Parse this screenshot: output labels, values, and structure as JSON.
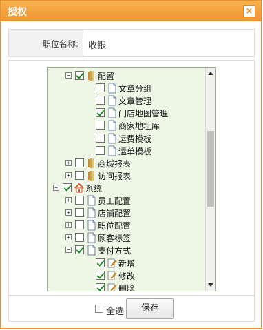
{
  "dialog": {
    "title": "授权",
    "close_label": "×"
  },
  "field": {
    "label": "职位名称:",
    "value": "收银"
  },
  "tree": {
    "nodes": [
      {
        "label": "配置",
        "expander": "−",
        "checked": true,
        "icon": "folder-icon"
      },
      {
        "label": "文章分组",
        "expander": "",
        "checked": false,
        "icon": "page-icon"
      },
      {
        "label": "文章管理",
        "expander": "",
        "checked": false,
        "icon": "page-icon"
      },
      {
        "label": "门店地图管理",
        "expander": "",
        "checked": true,
        "icon": "page-icon"
      },
      {
        "label": "商家地址库",
        "expander": "",
        "checked": false,
        "icon": "page-icon"
      },
      {
        "label": "运费模板",
        "expander": "",
        "checked": false,
        "icon": "page-icon"
      },
      {
        "label": "运单模板",
        "expander": "",
        "checked": false,
        "icon": "page-icon"
      },
      {
        "label": "商城报表",
        "expander": "+",
        "checked": false,
        "icon": "folder-icon"
      },
      {
        "label": "访问报表",
        "expander": "+",
        "checked": false,
        "icon": "folder-icon"
      },
      {
        "label": "系统",
        "expander": "−",
        "checked": true,
        "icon": "home-icon"
      },
      {
        "label": "员工配置",
        "expander": "+",
        "checked": false,
        "icon": "page-icon"
      },
      {
        "label": "店铺配置",
        "expander": "+",
        "checked": false,
        "icon": "page-icon"
      },
      {
        "label": "职位配置",
        "expander": "+",
        "checked": false,
        "icon": "page-icon"
      },
      {
        "label": "顾客标签",
        "expander": "+",
        "checked": false,
        "icon": "page-icon"
      },
      {
        "label": "支付方式",
        "expander": "−",
        "checked": true,
        "icon": "page-icon"
      },
      {
        "label": "新增",
        "expander": "",
        "checked": true,
        "icon": "edit-icon"
      },
      {
        "label": "修改",
        "expander": "",
        "checked": true,
        "icon": "edit-icon"
      },
      {
        "label": "删除",
        "expander": "",
        "checked": true,
        "icon": "edit-icon"
      }
    ]
  },
  "footer": {
    "select_all_label": "全选",
    "select_all_checked": false,
    "save_label": "保存"
  },
  "colors": {
    "title_bar": "#ee9431",
    "tree_bg": "#eef6e6",
    "check_green": "#1f8a1f"
  }
}
